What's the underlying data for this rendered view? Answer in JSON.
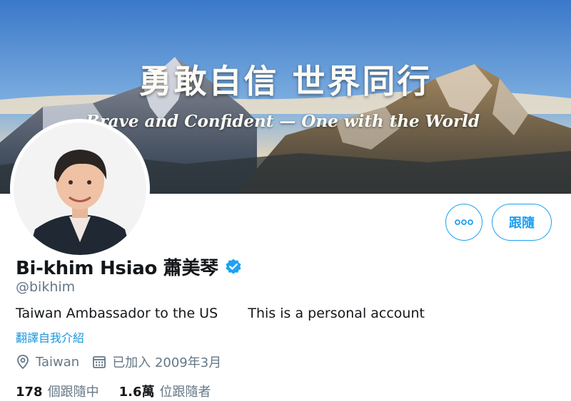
{
  "banner": {
    "title": "勇敢自信 世界同行",
    "subtitle": "Brave and Confident — One with the World"
  },
  "actions": {
    "more_icon": "more-dots-icon",
    "follow_label": "跟隨"
  },
  "profile": {
    "display_name": "Bi-khim Hsiao 蕭美琴",
    "verified_icon": "verified-badge-icon",
    "handle": "@bikhim",
    "bio": "Taiwan Ambassador to the US       This is a personal account",
    "translate_label": "翻譯自我介紹",
    "location": "Taiwan",
    "location_icon": "location-pin-icon",
    "joined": "已加入 2009年3月",
    "joined_icon": "calendar-icon"
  },
  "stats": {
    "following_count": "178",
    "following_label": "個跟隨中",
    "followers_count": "1.6萬",
    "followers_label": "位跟隨者"
  },
  "colors": {
    "accent": "#1da1f2",
    "secondary_text": "#657786"
  }
}
